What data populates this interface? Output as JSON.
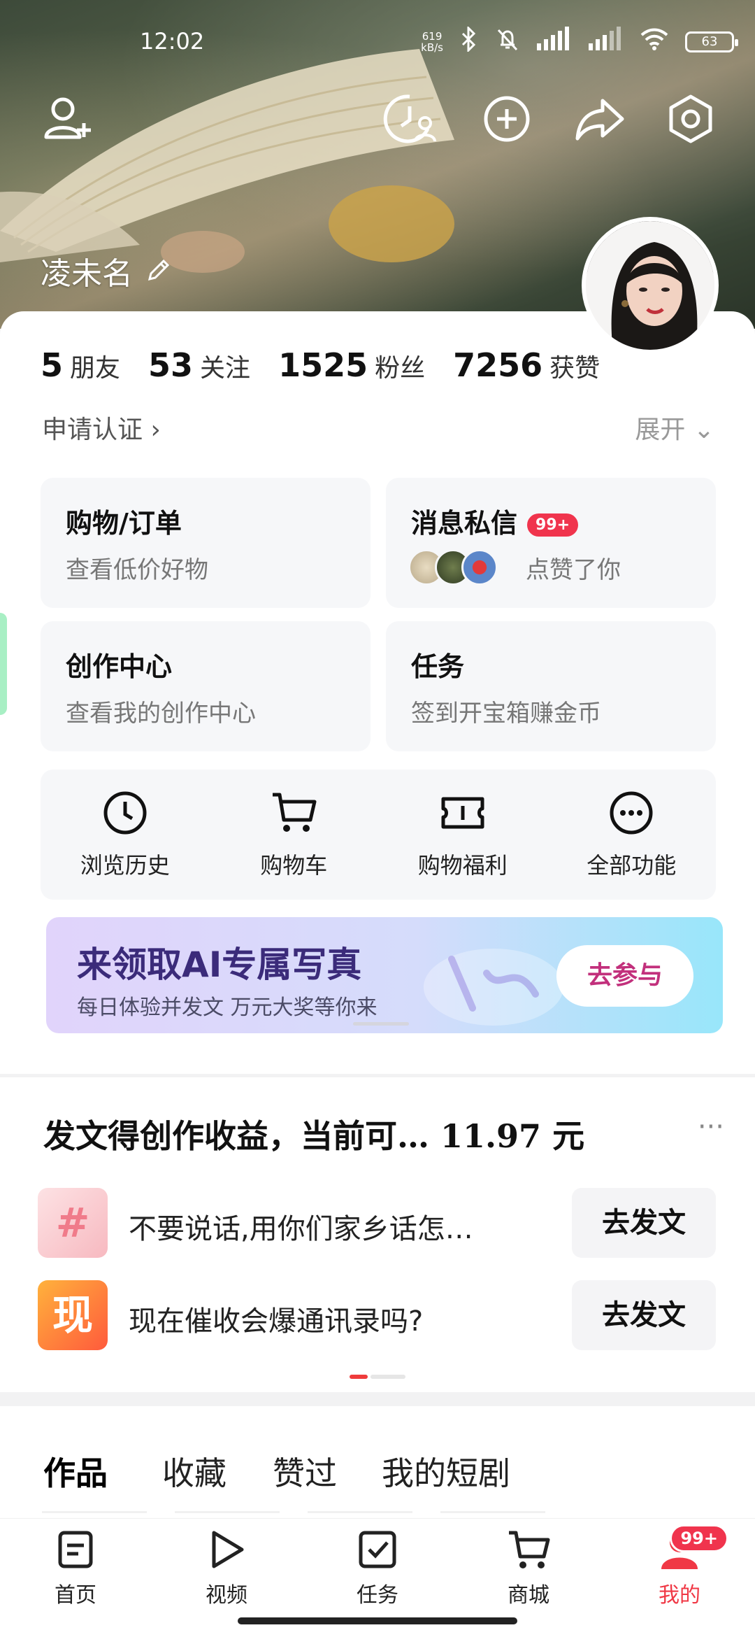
{
  "status": {
    "time": "12:02",
    "net_speed_top": "619",
    "net_speed_bottom": "kB/s",
    "battery": "63"
  },
  "header": {
    "username": "凌未名"
  },
  "stats": [
    {
      "num": "5",
      "label": "朋友"
    },
    {
      "num": "53",
      "label": "关注"
    },
    {
      "num": "1525",
      "label": "粉丝"
    },
    {
      "num": "7256",
      "label": "获赞"
    }
  ],
  "verify_label": "申请认证 ›",
  "expand_label": "展开 ⌄",
  "tiles": {
    "shopping": {
      "title": "购物/订单",
      "sub": "查看低价好物"
    },
    "messages": {
      "title": "消息私信",
      "badge": "99+",
      "sub": "点赞了你"
    },
    "creator": {
      "title": "创作中心",
      "sub": "查看我的创作中心"
    },
    "tasks": {
      "title": "任务",
      "sub": "签到开宝箱赚金币"
    }
  },
  "quick": [
    {
      "label": "浏览历史",
      "icon": "clock-icon"
    },
    {
      "label": "购物车",
      "icon": "cart-icon"
    },
    {
      "label": "购物福利",
      "icon": "ticket-icon"
    },
    {
      "label": "全部功能",
      "icon": "more-icon"
    }
  ],
  "banner": {
    "title": "来领取AI专属写真",
    "sub": "每日体验并发文 万元大奖等你来",
    "button": "去参与"
  },
  "earn": {
    "title": "发文得创作收益，当前可… 11.97 元",
    "more": "···",
    "rows": [
      {
        "icon_text": "#",
        "text": "不要说话,用你们家乡话怎…",
        "button": "去发文"
      },
      {
        "icon_text": "现",
        "text": "现在催收会爆通讯录吗?",
        "button": "去发文"
      }
    ]
  },
  "tabs": [
    "作品",
    "收藏",
    "赞过",
    "我的短剧"
  ],
  "nav": [
    {
      "label": "首页",
      "icon": "home-doc-icon"
    },
    {
      "label": "视频",
      "icon": "play-icon"
    },
    {
      "label": "任务",
      "icon": "task-check-icon"
    },
    {
      "label": "商城",
      "icon": "mall-cart-icon"
    },
    {
      "label": "我的",
      "icon": "profile-icon",
      "badge": "99+"
    }
  ],
  "colors": {
    "accent": "#f03845",
    "banner_button": "#c2307c"
  }
}
